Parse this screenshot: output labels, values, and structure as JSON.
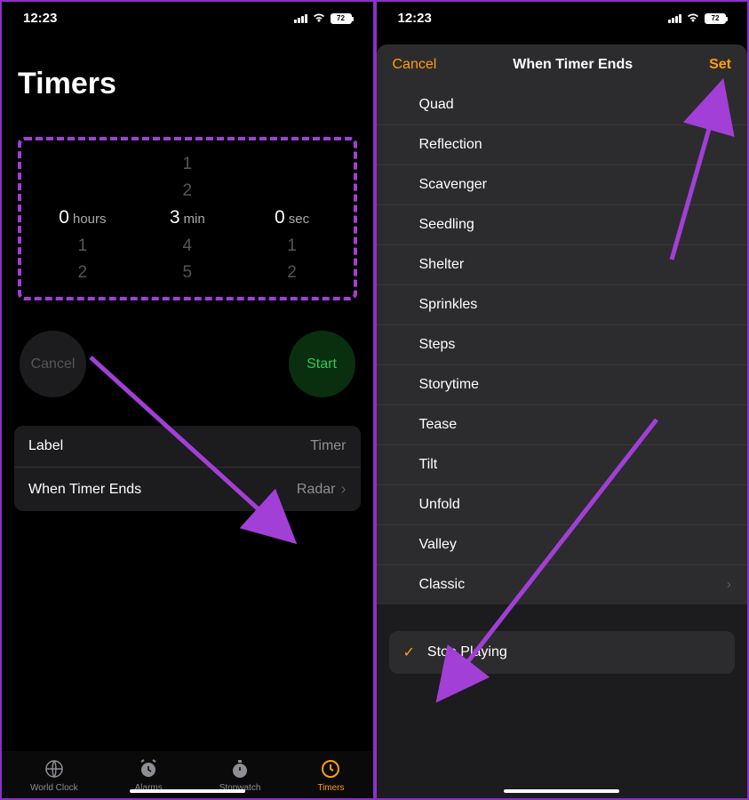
{
  "status": {
    "time": "12:23",
    "battery": "72"
  },
  "left": {
    "title": "Timers",
    "picker": {
      "hours": {
        "above": [],
        "selected": "0",
        "unit": "hours",
        "below": [
          "1",
          "2"
        ]
      },
      "minutes": {
        "above": [
          "1",
          "2"
        ],
        "selected": "3",
        "unit": "min",
        "below": [
          "4",
          "5"
        ]
      },
      "seconds": {
        "above": [],
        "selected": "0",
        "unit": "sec",
        "below": [
          "1",
          "2"
        ]
      }
    },
    "cancel": "Cancel",
    "start": "Start",
    "settings": {
      "label_title": "Label",
      "label_value": "Timer",
      "ends_title": "When Timer Ends",
      "ends_value": "Radar"
    },
    "tabs": {
      "world_clock": "World Clock",
      "alarms": "Alarms",
      "stopwatch": "Stopwatch",
      "timers": "Timers"
    }
  },
  "right": {
    "cancel": "Cancel",
    "title": "When Timer Ends",
    "set": "Set",
    "sounds": [
      "Quad",
      "Reflection",
      "Scavenger",
      "Seedling",
      "Shelter",
      "Sprinkles",
      "Steps",
      "Storytime",
      "Tease",
      "Tilt",
      "Unfold",
      "Valley",
      "Classic"
    ],
    "stop_playing": "Stop Playing"
  }
}
